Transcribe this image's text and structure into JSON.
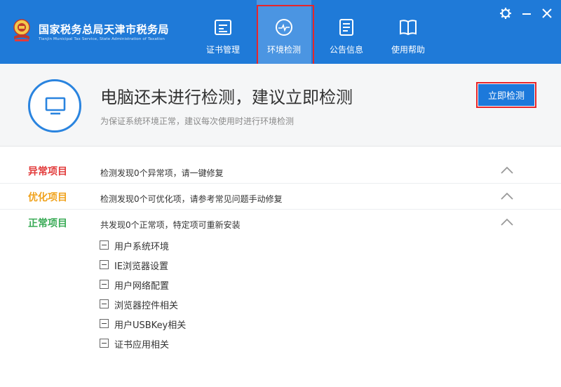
{
  "app": {
    "title": "国家税务总局天津市税务局",
    "subtitle": "Tianjin Municipal Tax Service, State Administration of Taxation"
  },
  "nav": [
    {
      "label": "证书管理",
      "icon": "certificate-icon",
      "active": false
    },
    {
      "label": "环境检测",
      "icon": "monitor-check-icon",
      "active": true
    },
    {
      "label": "公告信息",
      "icon": "document-icon",
      "active": false
    },
    {
      "label": "使用帮助",
      "icon": "book-icon",
      "active": false
    }
  ],
  "window_controls": [
    "settings-icon",
    "minimize-icon",
    "close-icon"
  ],
  "status": {
    "title": "电脑还未进行检测，建议立即检测",
    "subtitle": "为保证系统环境正常，建议每次使用时进行环境检测",
    "check_button": "立即检测"
  },
  "results": [
    {
      "label": "异常项目",
      "desc": "检测发现0个异常项，请一键修复",
      "color": "#e23b3b"
    },
    {
      "label": "优化项目",
      "desc": "检测发现0个可优化项，请参考常见问题手动修复",
      "color": "#f0a21c"
    },
    {
      "label": "正常项目",
      "desc": "共发现0个正常项，特定项可重新安装",
      "color": "#3aab57"
    }
  ],
  "normal_items": [
    "用户系统环境",
    "IE浏览器设置",
    "用户网络配置",
    "浏览器控件相关",
    "用户USBKey相关",
    "证书应用相关"
  ],
  "colors": {
    "header_bg": "#1f7ad8",
    "active_tab_bg": "#4b95e2",
    "highlight_border": "#e8262a",
    "accent": "#1c79db"
  }
}
